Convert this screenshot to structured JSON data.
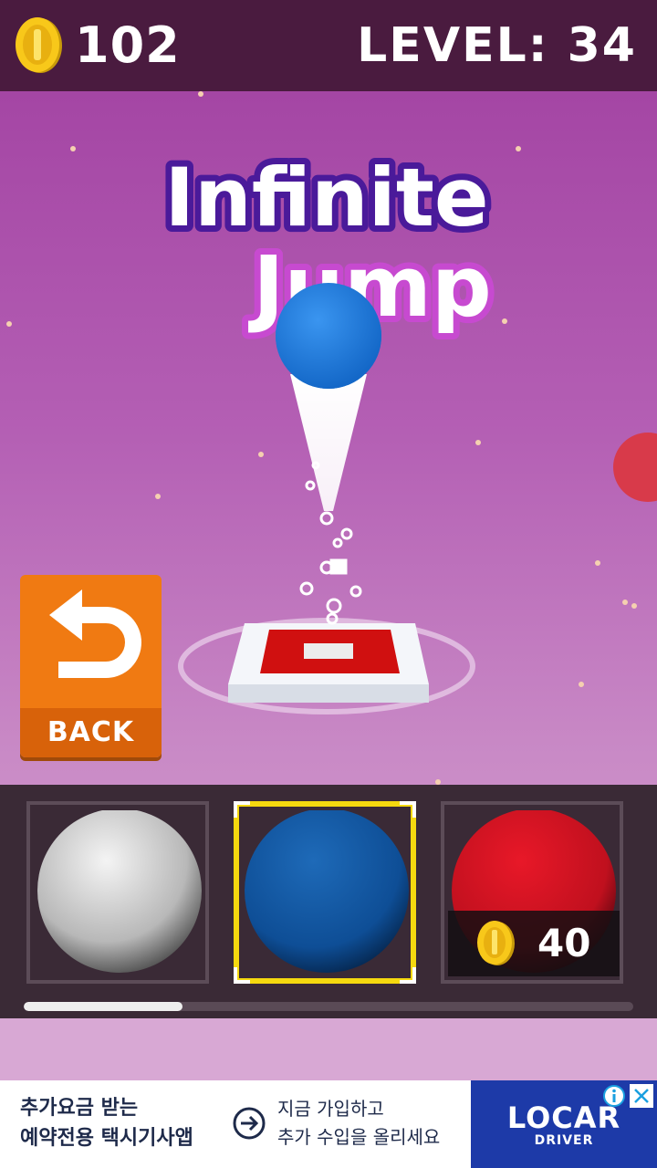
{
  "header": {
    "coins": "102",
    "level_label": "LEVEL: 34"
  },
  "title": {
    "line1": "Infinite",
    "line2": "Jump"
  },
  "back_button": {
    "label": "BACK"
  },
  "shop": {
    "selected_index": 1,
    "balls": [
      {
        "color": "#d9d9d9",
        "locked": false
      },
      {
        "color": "#1a5fb0",
        "locked": false
      },
      {
        "color": "#d8182a",
        "locked": true,
        "price": "40"
      }
    ],
    "scroll_progress": 0.26
  },
  "ad": {
    "left_line1": "추가요금 받는",
    "left_line2": "예약전용 택시기사앱",
    "mid_line1": "지금 가입하고",
    "mid_line2": "추가 수입을 올리세요",
    "brand": "LOCAR",
    "brand_sub": "DRIVER"
  },
  "colors": {
    "player_ball": "#1e7be0",
    "platform_red": "#d01010",
    "accent_yellow": "#f5d90f",
    "back_orange": "#f07a12"
  }
}
